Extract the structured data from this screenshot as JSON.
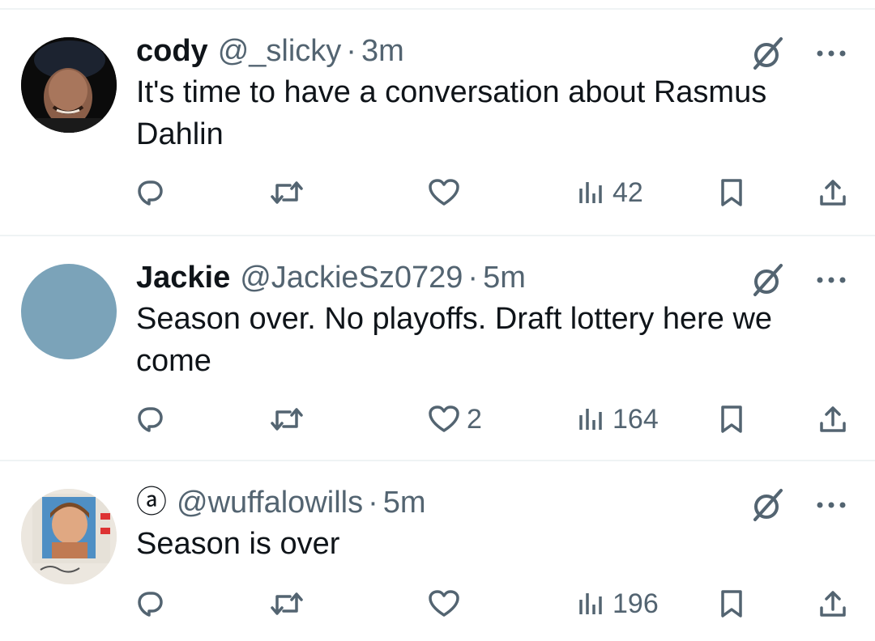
{
  "tweets": [
    {
      "name": "cody",
      "handle": "@_slicky",
      "separator": "·",
      "time": "3m",
      "text": "It's time to have a conversation about Rasmus Dahlin",
      "likes": "",
      "views": "42",
      "avatar": "dark-photo-avatar"
    },
    {
      "name": "Jackie",
      "handle": "@JackieSz0729",
      "separator": "·",
      "time": "5m",
      "text": "Season over. No playoffs. Draft lottery here we come",
      "likes": "2",
      "views": "164",
      "avatar": "blue-default-avatar"
    },
    {
      "name": "ⓐ",
      "handle": "@wuffalowills",
      "separator": "·",
      "time": "5m",
      "text": "Season is over",
      "likes": "",
      "views": "196",
      "avatar": "id-card-photo-avatar"
    }
  ],
  "icons": {
    "reply": "reply-icon",
    "retweet": "retweet-icon",
    "like": "heart-icon",
    "views": "views-icon",
    "bookmark": "bookmark-icon",
    "share": "share-icon",
    "grok": "grok-icon",
    "more": "more-icon"
  },
  "colors": {
    "text": "#0f1419",
    "secondary": "#536471",
    "divider": "#eff3f4",
    "default_avatar": "#7ba3b9"
  }
}
